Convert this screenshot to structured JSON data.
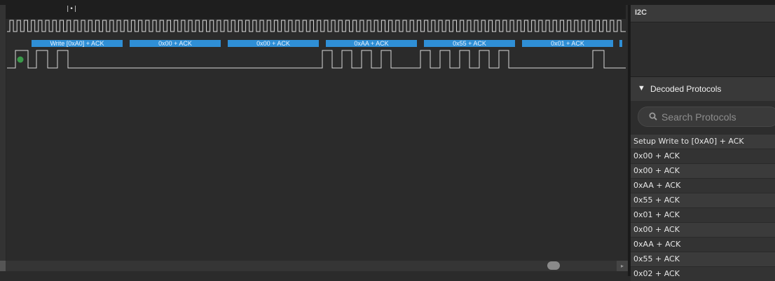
{
  "analyzer": {
    "ruler_marker": "|•|",
    "packets": [
      "Write [0xA0] + ACK",
      "0x00 + ACK",
      "0x00 + ACK",
      "0xAA + ACK",
      "0x55 + ACK",
      "0x01 + ACK"
    ]
  },
  "panel": {
    "title": "I2C",
    "decoded_header": "Decoded Protocols",
    "decoded_arrow": "▼",
    "search_placeholder": "Search Protocols",
    "rows": [
      "Setup Write to [0xA0] + ACK",
      "0x00 + ACK",
      "0x00 + ACK",
      "0xAA + ACK",
      "0x55 + ACK",
      "0x01 + ACK",
      "0x00 + ACK",
      "0xAA + ACK",
      "0x55 + ACK",
      "0x02 + ACK"
    ]
  },
  "colors": {
    "packet": "#2f8fd6",
    "trace": "#d9d9d9",
    "channel_dot": "#3a9a4a"
  }
}
